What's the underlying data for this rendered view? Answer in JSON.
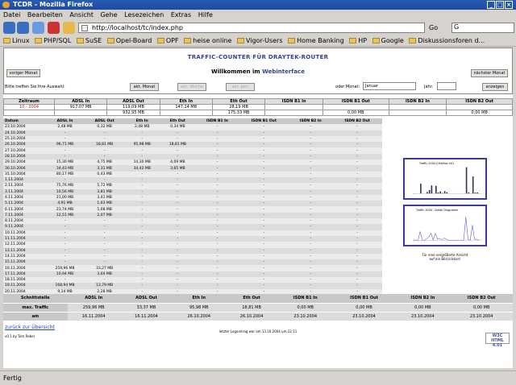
{
  "window": {
    "title": "TCDR - Mozilla Firefox",
    "btns": [
      "_",
      "□",
      "×"
    ]
  },
  "menu": [
    "Datei",
    "Bearbeiten",
    "Ansicht",
    "Gehe",
    "Lesezeichen",
    "Extras",
    "Hilfe"
  ],
  "nav": {
    "url": "http://localhost/tc/index.php",
    "go": "Go",
    "search_value": "G"
  },
  "bookmarks": [
    "Linux",
    "PHP/SQL",
    "SuSE",
    "Opel-Board",
    "OPF",
    "heise online",
    "Vigor-Users",
    "Home Banking",
    "HP",
    "Google",
    "Diskussionsforen d..."
  ],
  "page": {
    "title": "TRAFFIC-COUNTER FÜR DRAYTEK-ROUTER",
    "welcome_prefix": "Willkommen im",
    "welcome_word": "Webinterface",
    "prev_btn": "voriger Monat",
    "next_btn": "nächster Monat",
    "hint": "Bitte treffen Sie Ihre Auswahl:",
    "akt_btn": "akt. Monat",
    "btn_b": "akt. Woche",
    "btn_c": "akt. Jahr",
    "oder_monat": "oder Monat:",
    "month_value": "Januar",
    "jahr": "Jahr:",
    "show_btn": "anzeigen"
  },
  "summary": {
    "headers": [
      "Zeitraum",
      "ADSL In",
      "ADSL Out",
      "Eth In",
      "Eth Out",
      "ISDN B1 In",
      "ISDN B1 Out",
      "ISDN B2 In",
      "ISDN B2 Out"
    ],
    "row1": [
      "10 - 2004",
      "917,07 MB",
      "119,09 MB",
      "147,14 MB",
      "28,19 MB",
      "",
      "",
      "",
      ""
    ],
    "row2": [
      "",
      "",
      "932,95 MB",
      "",
      "175,33 MB",
      "",
      "0,00 MB",
      "",
      "0,00 MB"
    ]
  },
  "daily": {
    "headers": [
      "Datum",
      "ADSL In",
      "ADSL Out",
      "Eth In",
      "Eth Out",
      "ISDN B1 In",
      "ISDN B1 Out",
      "ISDN B2 In",
      "ISDN B2 Out"
    ],
    "rows": [
      [
        "23.10.2004",
        "2,48 MB",
        "0,32 MB",
        "2,48 MB",
        "0,34 MB",
        "-",
        "-",
        "-",
        "-"
      ],
      [
        "24.10.2004",
        "-",
        "-",
        "-",
        "-",
        "-",
        "-",
        "-",
        "-"
      ],
      [
        "25.10.2004",
        "-",
        "-",
        "-",
        "-",
        "-",
        "-",
        "-",
        "-"
      ],
      [
        "26.10.2004",
        "96,71 MB",
        "18,81 MB",
        "95,98 MB",
        "18,81 MB",
        "-",
        "-",
        "-",
        "-"
      ],
      [
        "27.10.2004",
        "-",
        "-",
        "-",
        "-",
        "-",
        "-",
        "-",
        "-"
      ],
      [
        "28.10.2004",
        "-",
        "-",
        "-",
        "-",
        "-",
        "-",
        "-",
        "-"
      ],
      [
        "29.10.2004",
        "15,30 MB",
        "4,75 MB",
        "14,30 MB",
        "4,09 MB",
        "-",
        "-",
        "-",
        "-"
      ],
      [
        "30.10.2004",
        "34,43 MB",
        "3,31 MB",
        "34,42 MB",
        "3,65 MB",
        "-",
        "-",
        "-",
        "-"
      ],
      [
        "31.10.2004",
        "80,17 MB",
        "0,43 MB",
        "-",
        "-",
        "-",
        "-",
        "-",
        "-"
      ],
      [
        "1.11.2004",
        "-",
        "-",
        "-",
        "-",
        "-",
        "-",
        "-",
        "-"
      ],
      [
        "2.11.2004",
        "75,76 MB",
        "5,72 MB",
        "-",
        "-",
        "-",
        "-",
        "-",
        "-"
      ],
      [
        "3.11.2004",
        "10,56 MB",
        "3,81 MB",
        "-",
        "-",
        "-",
        "-",
        "-",
        "-"
      ],
      [
        "4.11.2004",
        "21,00 MB",
        "3,41 MB",
        "-",
        "-",
        "-",
        "-",
        "-",
        "-"
      ],
      [
        "5.11.2004",
        "4,91 MB",
        "1,63 MB",
        "-",
        "-",
        "-",
        "-",
        "-",
        "-"
      ],
      [
        "6.11.2004",
        "23,74 MB",
        "5,68 MB",
        "-",
        "-",
        "-",
        "-",
        "-",
        "-"
      ],
      [
        "7.11.2004",
        "12,51 MB",
        "2,07 MB",
        "-",
        "-",
        "-",
        "-",
        "-",
        "-"
      ],
      [
        "8.11.2004",
        "-",
        "-",
        "-",
        "-",
        "-",
        "-",
        "-",
        "-"
      ],
      [
        "9.11.2004",
        "-",
        "-",
        "-",
        "-",
        "-",
        "-",
        "-",
        "-"
      ],
      [
        "10.11.2004",
        "-",
        "-",
        "-",
        "-",
        "-",
        "-",
        "-",
        "-"
      ],
      [
        "11.11.2004",
        "-",
        "-",
        "-",
        "-",
        "-",
        "-",
        "-",
        "-"
      ],
      [
        "12.11.2004",
        "-",
        "-",
        "-",
        "-",
        "-",
        "-",
        "-",
        "-"
      ],
      [
        "13.11.2004",
        "-",
        "-",
        "-",
        "-",
        "-",
        "-",
        "-",
        "-"
      ],
      [
        "14.11.2004",
        "-",
        "-",
        "-",
        "-",
        "-",
        "-",
        "-",
        "-"
      ],
      [
        "15.11.2004",
        "-",
        "-",
        "-",
        "-",
        "-",
        "-",
        "-",
        "-"
      ],
      [
        "16.11.2004",
        "259,96 MB",
        "33,27 MB",
        "-",
        "-",
        "-",
        "-",
        "-",
        "-"
      ],
      [
        "17.11.2004",
        "10,94 MB",
        "3,64 MB",
        "-",
        "-",
        "-",
        "-",
        "-",
        "-"
      ],
      [
        "18.11.2004",
        "-",
        "-",
        "-",
        "-",
        "-",
        "-",
        "-",
        "-"
      ],
      [
        "19.11.2004",
        "168,94 MB",
        "13,79 MB",
        "-",
        "-",
        "-",
        "-",
        "-",
        "-"
      ],
      [
        "20.11.2004",
        "9,14 MB",
        "2,28 MB",
        "-",
        "-",
        "-",
        "-",
        "-",
        "-"
      ],
      [
        "21.11.2004",
        "11,23 MB",
        "2,07 MB",
        "-",
        "-",
        "-",
        "-",
        "-",
        "-"
      ],
      [
        "22.11.2004",
        "-",
        "-",
        "-",
        "-",
        "-",
        "-",
        "-",
        "-"
      ]
    ]
  },
  "graphs": {
    "g1_title": "Traffic 2004 (Okt/Nov 04)",
    "g2_title": "Traffic 2004 - Detail Diagramm",
    "caption1": "Für eine vergrößerte Ansicht",
    "caption2": "auf ein Bild klicken!",
    "bar_values": [
      2.48,
      0,
      0,
      96.71,
      0,
      0,
      15.3,
      34.43,
      80.17,
      0,
      75.76,
      10.56,
      21,
      4.91,
      23.74,
      12.51,
      0,
      0,
      0,
      0,
      0,
      0,
      0,
      0,
      259.96,
      10.94,
      0,
      168.94,
      9.14,
      11.23,
      0
    ],
    "bar_color": "#3a2a5a",
    "line_color": "#3a3ad0"
  },
  "bottom": {
    "headers": [
      "Schnittstelle",
      "ADSL In",
      "ADSL Out",
      "Eth In",
      "Eth Out",
      "ISDN B1 In",
      "ISDN B1 Out",
      "ISDN B2 In",
      "ISDN B2 Out"
    ],
    "max_label": "max. Traffic",
    "max": [
      "259,96 MB",
      "33,37 MB",
      "95,98 MB",
      "18,81 MB",
      "0,00 MB",
      "0,00 MB",
      "0,00 MB",
      "0,00 MB"
    ],
    "am_label": "am",
    "am": [
      "16.11.2004",
      "16.11.2004",
      "26.10.2004",
      "26.10.2004",
      "23.10.2004",
      "23.10.2004",
      "23.10.2004",
      "23.10.2004"
    ]
  },
  "footer": {
    "back": "zurück zur Übersicht",
    "note": "letzter Logeintrag war am 13.10.2004 um 22:11",
    "version": "v0.1 by Tom Rebel",
    "w3c": "W3C HTML 4.01"
  },
  "status": "Fertig"
}
